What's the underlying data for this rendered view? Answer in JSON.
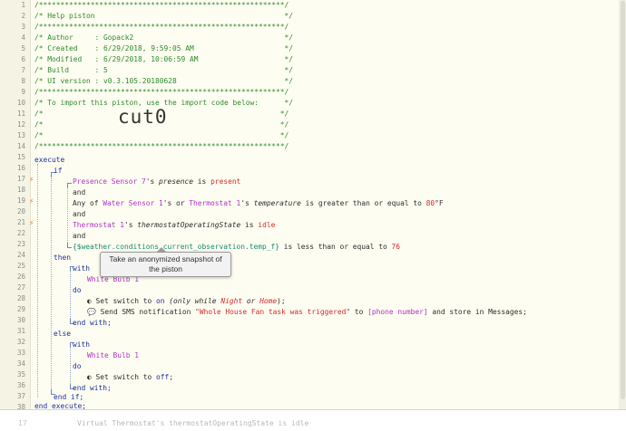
{
  "lines": [
    {
      "n": "1",
      "text": "/*********************************************************/"
    },
    {
      "n": "2",
      "text": "/* Help piston                                            */"
    },
    {
      "n": "3",
      "text": "/*********************************************************/"
    },
    {
      "n": "4",
      "text": "/* Author     : Gopack2                                   */"
    },
    {
      "n": "5",
      "text": "/* Created    : 6/29/2018, 9:59:05 AM                     */"
    },
    {
      "n": "6",
      "text": "/* Modified   : 6/29/2018, 10:06:59 AM                    */"
    },
    {
      "n": "7",
      "text": "/* Build      : 5                                         */"
    },
    {
      "n": "8",
      "text": "/* UI version : v0.3.105.20180628                         */"
    },
    {
      "n": "9",
      "text": "/*********************************************************/"
    },
    {
      "n": "10",
      "text": "/* To import this piston, use the import code below:      */"
    },
    {
      "n": "11",
      "text": "/*                                                       */"
    },
    {
      "n": "12",
      "text": "/*                                                       */"
    },
    {
      "n": "13",
      "text": "/*                                                       */"
    },
    {
      "n": "14",
      "text": "/*********************************************************/"
    }
  ],
  "import_code": "cut0",
  "line_numbers": [
    "15",
    "16",
    "17",
    "18",
    "19",
    "20",
    "21",
    "22",
    "23",
    "24",
    "25",
    "26",
    "27",
    "28",
    "29",
    "30",
    "31",
    "32",
    "33",
    "34",
    "35",
    "36",
    "37",
    "38",
    "39"
  ],
  "code": {
    "execute": "execute",
    "if": "if",
    "cond1_device": "Presence Sensor 7",
    "cond1_mid": "'s ",
    "cond1_attr": "presence",
    "cond1_op": " is ",
    "cond1_val": "present",
    "and1": "and",
    "cond2_pre": "Any of ",
    "cond2_dev1": "Water Sensor 1",
    "cond2_mid1": "'s or ",
    "cond2_dev2": "Thermostat 1",
    "cond2_mid2": "'s ",
    "cond2_attr": "temperature",
    "cond2_op": " is greater than or equal to ",
    "cond2_val": "80",
    "cond2_unit": "°F",
    "and2": "and",
    "cond3_device": "Thermostat 1",
    "cond3_mid": "'s ",
    "cond3_attr": "thermostatOperatingState",
    "cond3_op": " is ",
    "cond3_val": "idle",
    "and3": "and",
    "cond4_expr": "{$weather.conditions.current_observation.temp_f}",
    "cond4_op": " is less than or equal to ",
    "cond4_val": "76",
    "then": "then",
    "with1": "with",
    "with1_device": "White Bulb 1",
    "do1": "do",
    "action1_icon": "toggle-icon",
    "action1_pre": "Set switch to ",
    "action1_val": "on",
    "action1_cond_a": " (only while ",
    "action1_mode1": "Night",
    "action1_cond_b": " or ",
    "action1_mode2": "Home",
    "action1_cond_c": ");",
    "action2_icon": "sms-icon",
    "action2_pre": "Send SMS notification ",
    "action2_msg": "\"Whole House Fan task was triggered\"",
    "action2_mid": " to ",
    "action2_phone": "[phone number]",
    "action2_post": " and store in Messages;",
    "endwith1": "end with;",
    "else": "else",
    "with2": "with",
    "with2_device": "White Bulb 1",
    "do2": "do",
    "action3_pre": "Set switch to ",
    "action3_val": "off",
    "action3_post": ";",
    "endwith2": "end with;",
    "endif": "end if;",
    "endexecute": "end execute;"
  },
  "tooltip": "Take an anonymized snapshot of the piston",
  "bottom_ghost": {
    "line": "17",
    "text": "Virtual Thermostat's thermostatOperatingState is idle"
  },
  "colors": {
    "comment": "#2d8c2d",
    "keyword": "#1c2fa0",
    "device": "#b033c8",
    "value": "#d42a2a",
    "variable": "#178a6f",
    "bolt": "#f07a2a",
    "background": "#fefdf1"
  }
}
